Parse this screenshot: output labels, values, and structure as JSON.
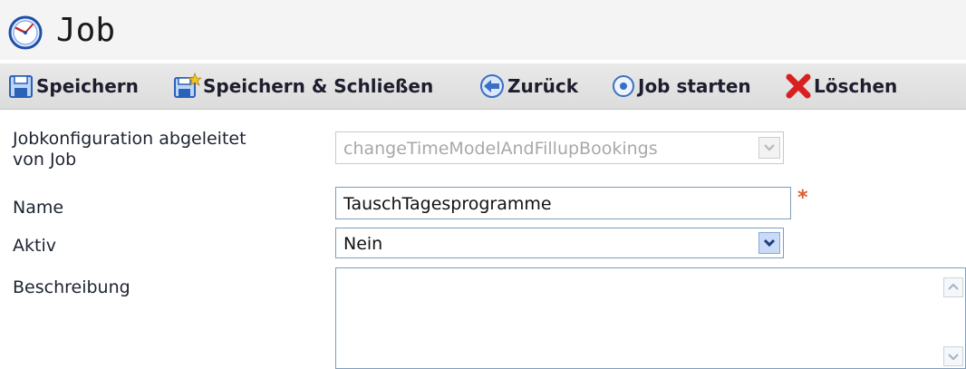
{
  "window": {
    "title": "Job",
    "title_icon": "clock-icon"
  },
  "toolbar": {
    "buttons": [
      {
        "label": "Speichern",
        "icon": "save-icon"
      },
      {
        "label": "Speichern & Schließen",
        "icon": "save-close-icon"
      },
      {
        "label": "Zurück",
        "icon": "back-arrow-icon"
      },
      {
        "label": "Job starten",
        "icon": "start-job-icon"
      },
      {
        "label": "Löschen",
        "icon": "delete-icon"
      }
    ]
  },
  "form": {
    "derived_from": {
      "label_line1": "Jobkonfiguration abgeleitet",
      "label_line2": "von Job",
      "value": "changeTimeModelAndFillupBookings",
      "disabled": true
    },
    "name": {
      "label": "Name",
      "value": "TauschTagesprogramme",
      "required_marker": "*"
    },
    "active": {
      "label": "Aktiv",
      "value": "Nein"
    },
    "description": {
      "label": "Beschreibung",
      "value": ""
    }
  },
  "colors": {
    "field_border": "#7f9db9",
    "required": "#e2582a",
    "toolbar_bg": "#dcdcdc",
    "delete_red": "#d92020"
  }
}
